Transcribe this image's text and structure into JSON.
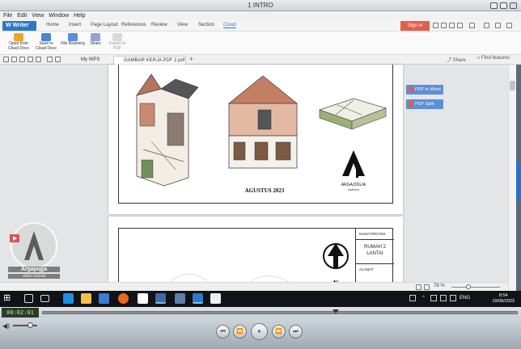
{
  "player": {
    "title": "1 INTRO",
    "menu": [
      "File",
      "Edit",
      "View",
      "Window",
      "Help"
    ],
    "time": "00:02:01"
  },
  "writer": {
    "app_name": "Writer",
    "ribbon_tabs": [
      "Home",
      "Insert",
      "Page Layout",
      "References",
      "Review",
      "View",
      "Section",
      "Cloud"
    ],
    "active_tab": "Cloud",
    "sign_in": "Sign in",
    "ribbon_buttons": [
      {
        "label": "Open from Cloud Docs"
      },
      {
        "label": "Save to Cloud Docs"
      },
      {
        "label": "File Roaming"
      },
      {
        "label": "Share"
      },
      {
        "label": "Export to PDF"
      }
    ],
    "share": "Share",
    "find": "Find features",
    "doc_tabs": [
      "My WPS",
      "GAMBAR KERJA PDF 2.pdf"
    ],
    "side_buttons": [
      "PDF to Word",
      "PDF Split"
    ],
    "zoom": "78 %"
  },
  "drawing": {
    "date_label": "AGUSTUS 2023",
    "logo_text": "ARGAJOGJA",
    "logo_sub": "arsitektur",
    "table": {
      "project_label": "NAMA PROYEK",
      "project_name": "RUMAH 2 LANTAI",
      "address_label": "ALAMAT"
    },
    "north": "N"
  },
  "watermark": {
    "brand": "Argajogja",
    "sub": "video tutorial"
  },
  "taskbar": {
    "lang": "ENG",
    "time": "8:54",
    "date": "19/08/2023"
  }
}
